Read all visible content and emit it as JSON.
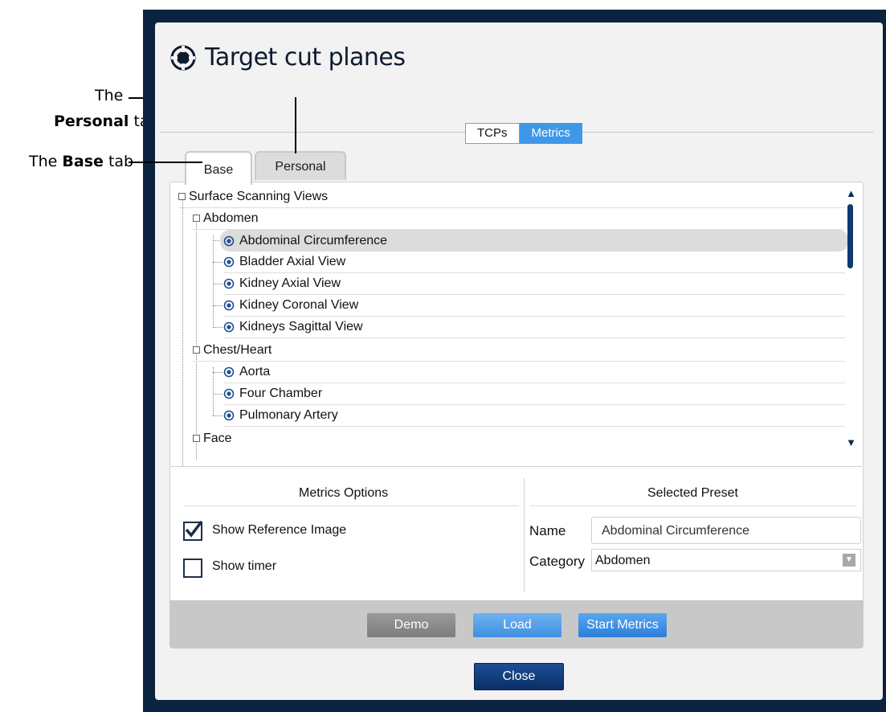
{
  "annotations": {
    "personal_line1": "The",
    "personal_bold": "Personal",
    "personal_suffix": "tab",
    "base_prefix": "The",
    "base_bold": "Base",
    "base_suffix": "tab"
  },
  "dialog": {
    "title": "Target cut planes",
    "icon": "crosshair-target-icon"
  },
  "mode_toggle": {
    "options": [
      "TCPs",
      "Metrics"
    ],
    "selected": "Metrics"
  },
  "tabs": [
    {
      "label": "Base",
      "active": true
    },
    {
      "label": "Personal",
      "active": false
    }
  ],
  "tree": {
    "root": "Surface Scanning Views",
    "groups": [
      {
        "label": "Abdomen",
        "items": [
          "Abdominal Circumference",
          "Bladder Axial View",
          "Kidney Axial View",
          "Kidney Coronal View",
          "Kidneys Sagittal View"
        ]
      },
      {
        "label": "Chest/Heart",
        "items": [
          "Aorta",
          "Four Chamber",
          "Pulmonary Artery"
        ]
      },
      {
        "label": "Face",
        "items": []
      }
    ],
    "selected_item": "Abdominal Circumference"
  },
  "metrics_options": {
    "title": "Metrics Options",
    "show_reference_image": {
      "label": "Show Reference Image",
      "checked": true
    },
    "show_timer": {
      "label": "Show timer",
      "checked": false
    }
  },
  "selected_preset": {
    "title": "Selected Preset",
    "name_label": "Name",
    "name_value": "Abdominal Circumference",
    "category_label": "Category",
    "category_value": "Abdomen"
  },
  "buttons": {
    "demo": "Demo",
    "load": "Load",
    "start_metrics": "Start Metrics",
    "close": "Close"
  },
  "colors": {
    "frame": "#0c2340",
    "accent_blue": "#3f97e8",
    "close_blue": "#0b2f66"
  }
}
